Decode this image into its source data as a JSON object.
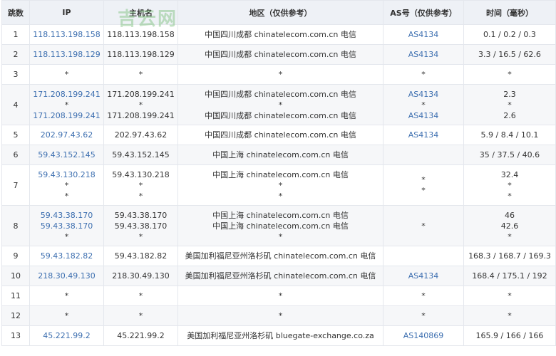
{
  "header": {
    "hop": "跳数",
    "ip": "IP",
    "host": "主机名",
    "region": "地区（仅供参考）",
    "as": "AS号（仅供参考）",
    "time": "时间（毫秒）"
  },
  "watermark": "吉云网",
  "rows": [
    {
      "hop": "1",
      "lines": [
        {
          "ip": "118.113.198.158",
          "host": "118.113.198.158",
          "region": "中国四川成都 chinatelecom.com.cn 电信",
          "as": "AS4134",
          "time": "0.1 / 0.2 / 0.3"
        }
      ]
    },
    {
      "hop": "2",
      "lines": [
        {
          "ip": "118.113.198.129",
          "host": "118.113.198.129",
          "region": "中国四川成都 chinatelecom.com.cn 电信",
          "as": "AS4134",
          "time": "3.3 / 16.5 / 62.6"
        }
      ]
    },
    {
      "hop": "3",
      "lines": [
        {
          "ip": "*",
          "host": "*",
          "region": "*",
          "as": "*",
          "time": "*"
        }
      ]
    },
    {
      "hop": "4",
      "lines": [
        {
          "ip": "171.208.199.241",
          "host": "171.208.199.241",
          "region": "中国四川成都 chinatelecom.com.cn 电信",
          "as": "AS4134",
          "time": "2.3"
        },
        {
          "ip": "*",
          "host": "*",
          "region": "*",
          "as": "*",
          "time": "*"
        },
        {
          "ip": "171.208.199.241",
          "host": "171.208.199.241",
          "region": "中国四川成都 chinatelecom.com.cn 电信",
          "as": "AS4134",
          "time": "2.6"
        }
      ]
    },
    {
      "hop": "5",
      "lines": [
        {
          "ip": "202.97.43.62",
          "host": "202.97.43.62",
          "region": "中国四川成都 chinatelecom.com.cn 电信",
          "as": "AS4134",
          "time": "5.9 / 8.4 / 10.1"
        }
      ]
    },
    {
      "hop": "6",
      "lines": [
        {
          "ip": "59.43.152.145",
          "host": "59.43.152.145",
          "region": "中国上海 chinatelecom.com.cn 电信",
          "as": "",
          "time": "35 / 37.5 / 40.6"
        }
      ]
    },
    {
      "hop": "7",
      "lines": [
        {
          "ip": "59.43.130.218",
          "host": "59.43.130.218",
          "region": "中国上海 chinatelecom.com.cn 电信",
          "as": "",
          "time": "32.4"
        },
        {
          "ip": "*",
          "host": "*",
          "region": "*",
          "as": "*",
          "time": "*"
        },
        {
          "ip": "*",
          "host": "*",
          "region": "*",
          "as": "*",
          "time": "*"
        }
      ]
    },
    {
      "hop": "8",
      "lines": [
        {
          "ip": "59.43.38.170",
          "host": "59.43.38.170",
          "region": "中国上海 chinatelecom.com.cn 电信",
          "as": "",
          "time": "46"
        },
        {
          "ip": "59.43.38.170",
          "host": "59.43.38.170",
          "region": "中国上海 chinatelecom.com.cn 电信",
          "as": "",
          "time": "42.6"
        },
        {
          "ip": "*",
          "host": "*",
          "region": "*",
          "as": "*",
          "time": "*"
        }
      ]
    },
    {
      "hop": "9",
      "lines": [
        {
          "ip": "59.43.182.82",
          "host": "59.43.182.82",
          "region": "美国加利福尼亚州洛杉矶 chinatelecom.com.cn 电信",
          "as": "",
          "time": "168.3 / 168.7 / 169.3"
        }
      ]
    },
    {
      "hop": "10",
      "lines": [
        {
          "ip": "218.30.49.130",
          "host": "218.30.49.130",
          "region": "美国加利福尼亚州洛杉矶 chinatelecom.com.cn 电信",
          "as": "AS4134",
          "time": "168.4 / 175.1 / 192"
        }
      ]
    },
    {
      "hop": "11",
      "lines": [
        {
          "ip": "*",
          "host": "*",
          "region": "*",
          "as": "*",
          "time": "*"
        }
      ]
    },
    {
      "hop": "12",
      "lines": [
        {
          "ip": "*",
          "host": "*",
          "region": "*",
          "as": "*",
          "time": "*"
        }
      ]
    },
    {
      "hop": "13",
      "lines": [
        {
          "ip": "45.221.99.2",
          "host": "45.221.99.2",
          "region": "美国加利福尼亚州洛杉矶 bluegate-exchange.co.za",
          "as": "AS140869",
          "time": "165.9 / 166 / 166"
        }
      ]
    }
  ]
}
